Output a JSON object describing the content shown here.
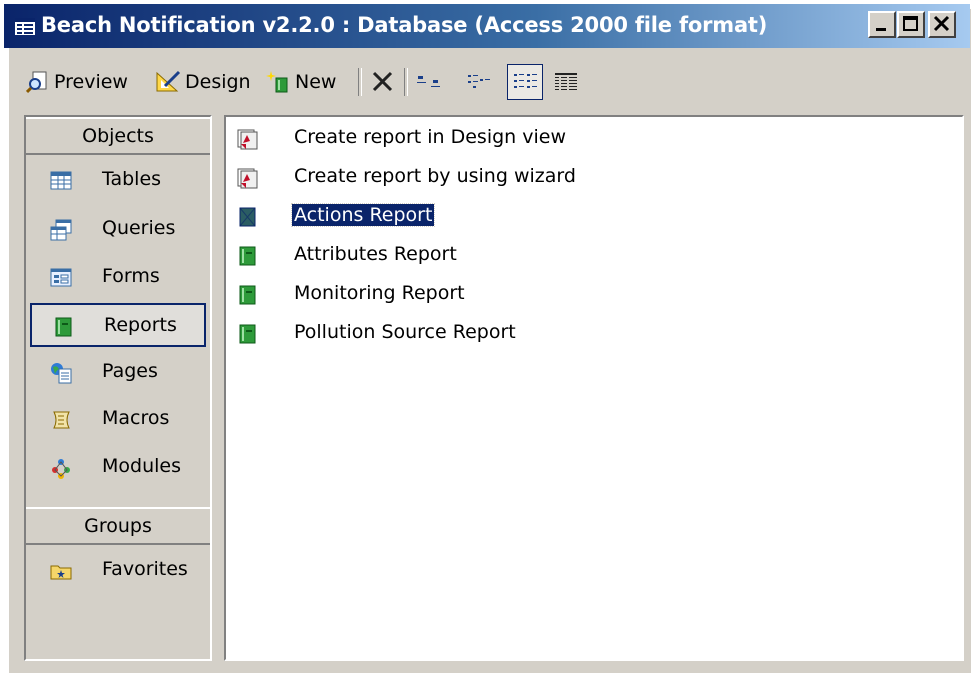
{
  "window": {
    "title": "Beach Notification v2.2.0 : Database (Access 2000 file format)",
    "controls": [
      "minimize",
      "maximize",
      "close"
    ]
  },
  "toolbar": {
    "preview_label": "Preview",
    "preview_key": "P",
    "design_label": "Design",
    "design_key": "D",
    "new_label": "New",
    "new_key": "N"
  },
  "objects_group": {
    "header": "Objects",
    "items": [
      {
        "label": "Tables",
        "icon": "table-icon"
      },
      {
        "label": "Queries",
        "icon": "query-icon"
      },
      {
        "label": "Forms",
        "icon": "form-icon"
      },
      {
        "label": "Reports",
        "icon": "report-icon",
        "selected": true
      },
      {
        "label": "Pages",
        "icon": "page-icon"
      },
      {
        "label": "Macros",
        "icon": "macro-icon"
      },
      {
        "label": "Modules",
        "icon": "module-icon"
      }
    ]
  },
  "groups_group": {
    "header": "Groups",
    "items": [
      {
        "label": "Favorites",
        "icon": "favorites-folder-icon"
      }
    ]
  },
  "report_list": {
    "items": [
      {
        "label": "Create report in Design view",
        "icon": "shortcut-icon"
      },
      {
        "label": "Create report by using wizard",
        "icon": "shortcut-icon"
      },
      {
        "label": "Actions Report",
        "icon": "report-icon",
        "selected": true
      },
      {
        "label": "Attributes Report",
        "icon": "report-icon"
      },
      {
        "label": "Monitoring Report",
        "icon": "report-icon"
      },
      {
        "label": "Pollution Source Report",
        "icon": "report-icon"
      }
    ]
  },
  "colors": {
    "title_bar_start": "#0a246a",
    "title_bar_end": "#a6caf0",
    "selection": "#0a246a",
    "face": "#d4d0c8"
  }
}
